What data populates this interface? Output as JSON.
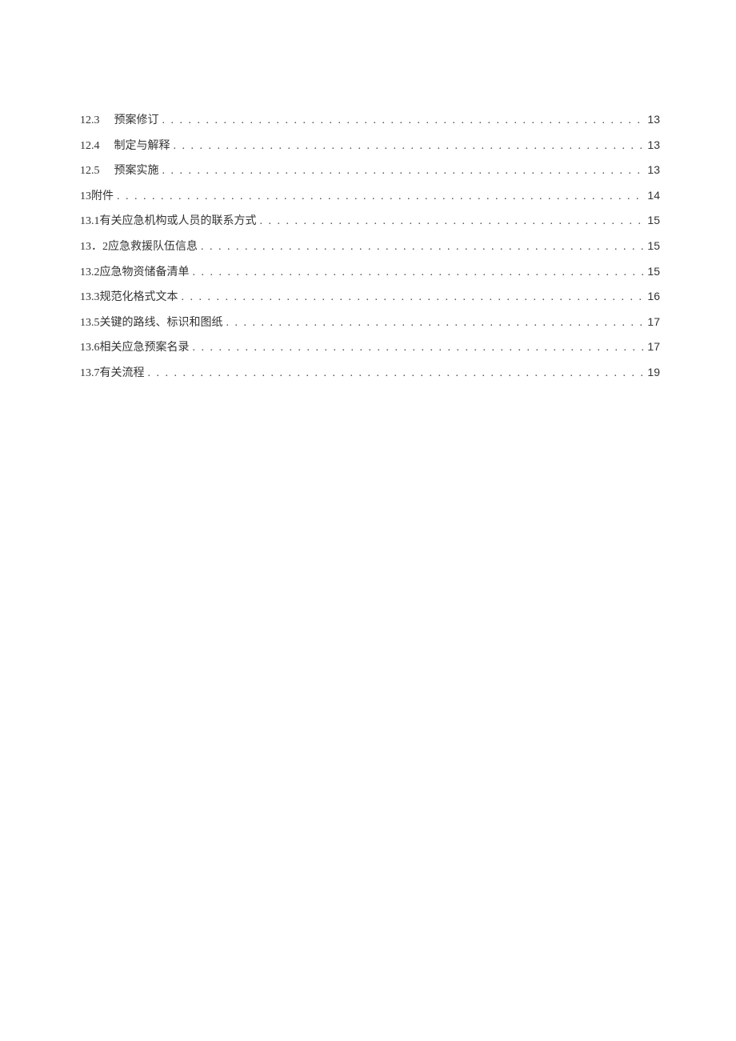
{
  "toc": {
    "entries": [
      {
        "num": "12.3",
        "title": "预案修订",
        "page": "13",
        "indent": true
      },
      {
        "num": "12.4",
        "title": "制定与解释",
        "page": "13",
        "indent": true
      },
      {
        "num": "12.5",
        "title": "预案实施",
        "page": "13",
        "indent": true
      },
      {
        "num": "13",
        "title": "附件",
        "page": "14",
        "indent": false,
        "join": true
      },
      {
        "num": "13.1",
        "title": "有关应急机构或人员的联系方式",
        "page": "15",
        "indent": false,
        "join": true
      },
      {
        "num": "13．2",
        "title": "应急救援队伍信息",
        "page": "15",
        "indent": false,
        "join": true
      },
      {
        "num": "13.2",
        "title": "应急物资储备清单",
        "page": "15",
        "indent": false,
        "join": true
      },
      {
        "num": "13.3",
        "title": "规范化格式文本",
        "page": "16",
        "indent": false,
        "join": true
      },
      {
        "num": "13.5",
        "title": "关键的路线、标识和图纸",
        "page": "17",
        "indent": false,
        "join": true
      },
      {
        "num": "13.6",
        "title": "相关应急预案名录",
        "page": "17",
        "indent": false,
        "join": true
      },
      {
        "num": "13.7",
        "title": "有关流程",
        "page": "19",
        "indent": false,
        "join": true
      }
    ]
  }
}
